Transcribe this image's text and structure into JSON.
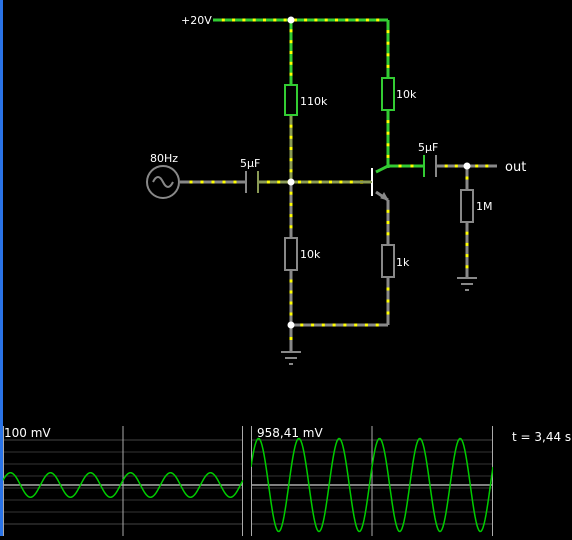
{
  "circuit": {
    "supply_label": "+20V",
    "source_label": "80Hz",
    "input_cap_label": "5µF",
    "output_cap_label": "5µF",
    "r_top_bias_label": "110k",
    "r_bottom_bias_label": "10k",
    "r_collector_label": "10k",
    "r_emitter_label": "1k",
    "r_load_label": "1M",
    "output_label": "out"
  },
  "scopes": [
    {
      "label": "100 mV",
      "amplitude_fraction": 0.25,
      "cycles": 6
    },
    {
      "label": "958,41 mV",
      "amplitude_fraction": 0.95,
      "cycles": 6
    }
  ],
  "time_label": "t = 3,44 s",
  "colors": {
    "wire_live": "#33cc33",
    "wire_ground": "#888888",
    "node_dot": "#ffff00",
    "trace": "#00cc00",
    "grid": "#666666"
  }
}
